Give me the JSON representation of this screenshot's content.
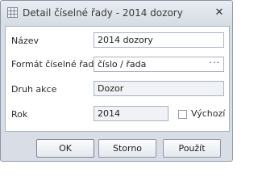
{
  "window": {
    "title": "Detail číselné řady - 2014 dozory",
    "close_symbol": "✕",
    "icon": "grid-icon"
  },
  "form": {
    "name": {
      "label": "Název",
      "value": "2014 dozory"
    },
    "format": {
      "label": "Formát číselné řady",
      "value": "číslo / řada",
      "button_text": "···"
    },
    "action_type": {
      "label": "Druh akce",
      "value": "Dozor"
    },
    "year": {
      "label": "Rok",
      "value": "2014"
    },
    "default": {
      "label": "Výchozí",
      "checked": false
    }
  },
  "buttons": {
    "ok": "OK",
    "cancel": "Storno",
    "apply": "Použít"
  },
  "colors": {
    "frame": "#d9dee6",
    "border": "#a9b3c1",
    "readonly_fill": "#f0f2f5"
  }
}
